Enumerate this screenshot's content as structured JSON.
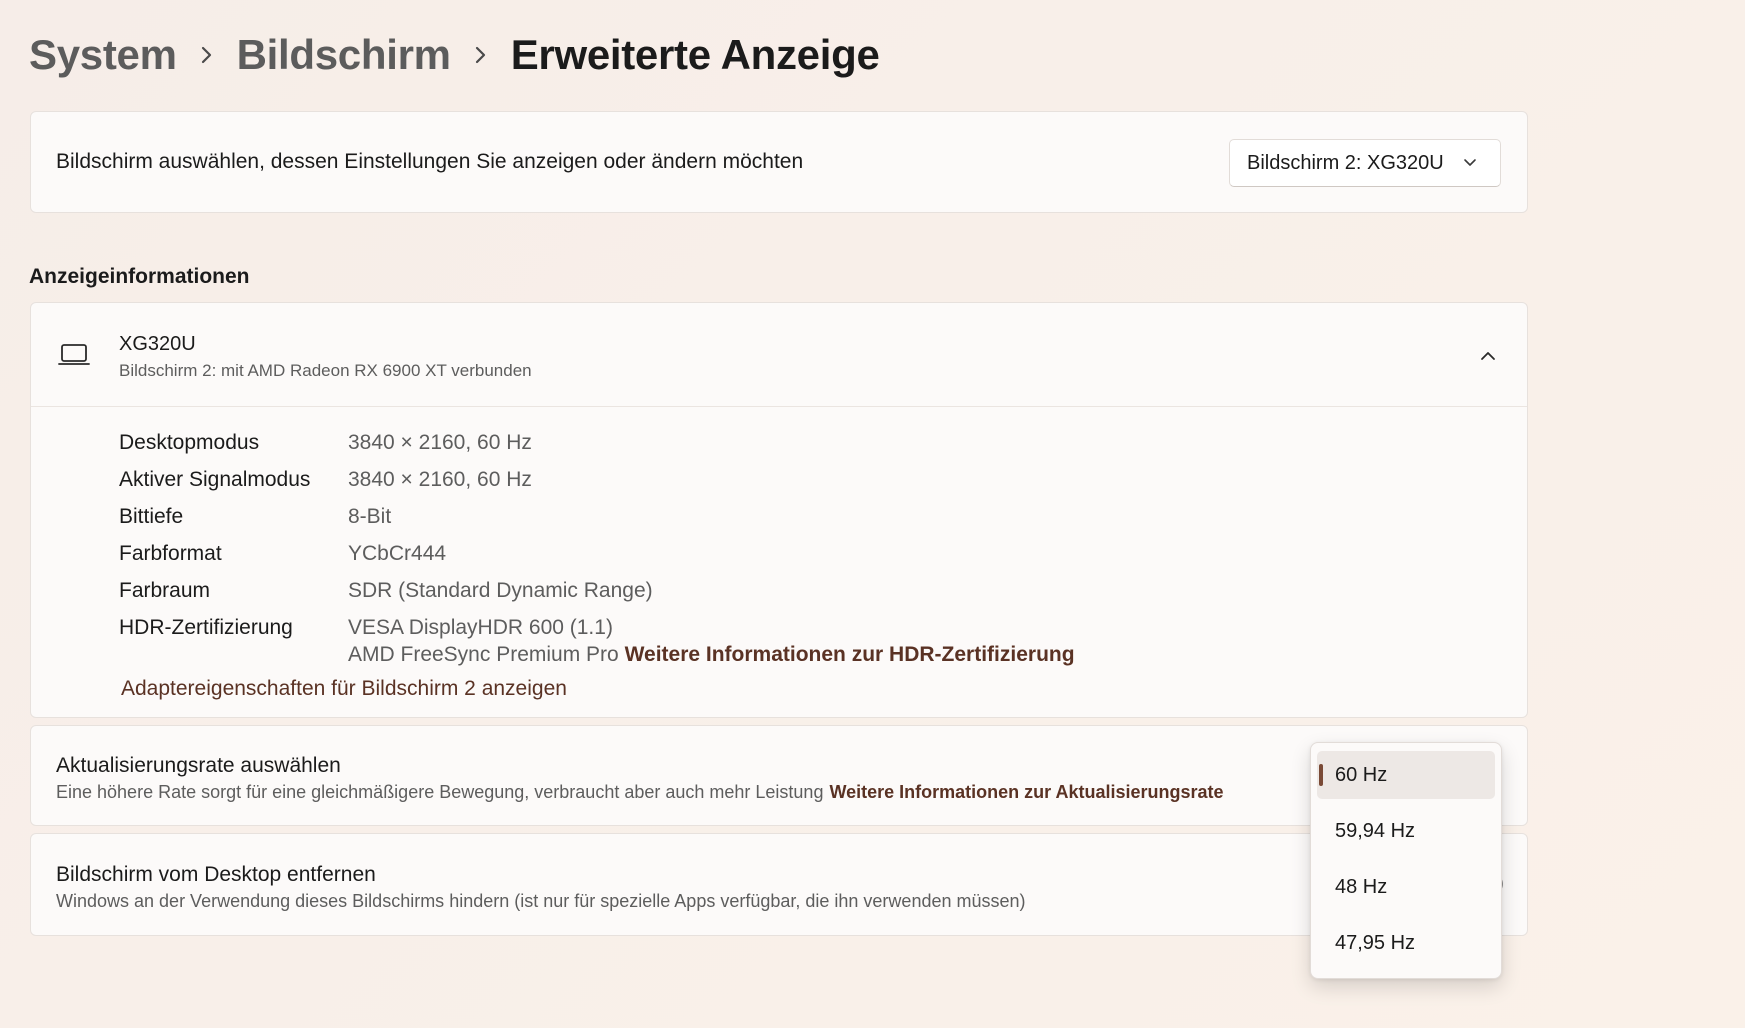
{
  "breadcrumb": {
    "items": [
      "System",
      "Bildschirm",
      "Erweiterte Anzeige"
    ]
  },
  "display_select": {
    "label": "Bildschirm auswählen, dessen Einstellungen Sie anzeigen oder ändern möchten",
    "selected": "Bildschirm 2: XG320U"
  },
  "section_title": "Anzeigeinformationen",
  "display_info": {
    "name": "XG320U",
    "subtitle": "Bildschirm 2: mit AMD Radeon RX 6900 XT verbunden",
    "rows": [
      {
        "key": "Desktopmodus",
        "value": "3840 × 2160, 60 Hz"
      },
      {
        "key": "Aktiver Signalmodus",
        "value": "3840 × 2160, 60 Hz"
      },
      {
        "key": "Bittiefe",
        "value": "8-Bit"
      },
      {
        "key": "Farbformat",
        "value": "YCbCr444"
      },
      {
        "key": "Farbraum",
        "value": "SDR (Standard Dynamic Range)"
      },
      {
        "key": "HDR-Zertifizierung",
        "value": "VESA DisplayHDR 600 (1.1)"
      }
    ],
    "hdr_extra": "AMD FreeSync Premium Pro",
    "hdr_link": "Weitere Informationen zur HDR-Zertifizierung",
    "adapter_link": "Adaptereigenschaften für Bildschirm 2 anzeigen"
  },
  "refresh_rate": {
    "title": "Aktualisierungsrate auswählen",
    "description": "Eine höhere Rate sorgt für eine gleichmäßigere Bewegung, verbraucht aber auch mehr Leistung",
    "link": "Weitere Informationen zur Aktualisierungsrate",
    "options": [
      "60 Hz",
      "59,94 Hz",
      "48 Hz",
      "47,95 Hz"
    ],
    "selected": "60 Hz"
  },
  "remove_display": {
    "title": "Bildschirm vom Desktop entfernen",
    "description": "Windows an der Verwendung dieses Bildschirms hindern (ist nur für spezielle Apps verfügbar, die ihn verwenden müssen)"
  },
  "colors": {
    "accent": "#7a4a36",
    "link": "#5a3224"
  },
  "icons": [
    "chevron-right-icon",
    "chevron-down-icon",
    "chevron-up-icon",
    "laptop-icon"
  ]
}
